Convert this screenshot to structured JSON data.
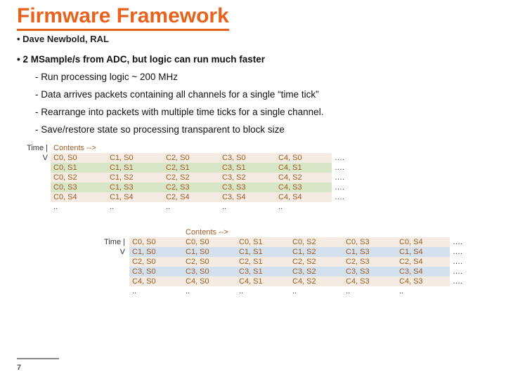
{
  "title": "Firmware Framework",
  "author": "Dave Newbold, RAL",
  "bullet1": "2 MSample/s from ADC, but logic can run much faster",
  "sub": {
    "a": "Run processing logic ~ 200 MHz",
    "b": "Data arrives packets containing all channels for a single “time tick”",
    "c": "Rearrange into packets with multiple time ticks for a single channel.",
    "d": "Save/restore state so processing transparent to block size"
  },
  "tableA": {
    "axis_top": "Time |",
    "axis_bot": "V",
    "contents_label": "Contents -->",
    "cols": [
      "C0",
      "C1",
      "C2",
      "C3",
      "C4"
    ],
    "rows": [
      "S0",
      "S1",
      "S2",
      "S3",
      "S4"
    ],
    "trail": "….",
    "dots": ".."
  },
  "tableB": {
    "axis_top": "Time |",
    "axis_bot": "V",
    "contents_label": "Contents -->",
    "rows_chan": [
      "C0",
      "C1",
      "C2",
      "C3",
      "C4"
    ],
    "cols_samp": [
      "S0",
      "S1",
      "S2",
      "S3",
      "S4"
    ],
    "trail": "….",
    "dots": ".."
  },
  "page": "7"
}
